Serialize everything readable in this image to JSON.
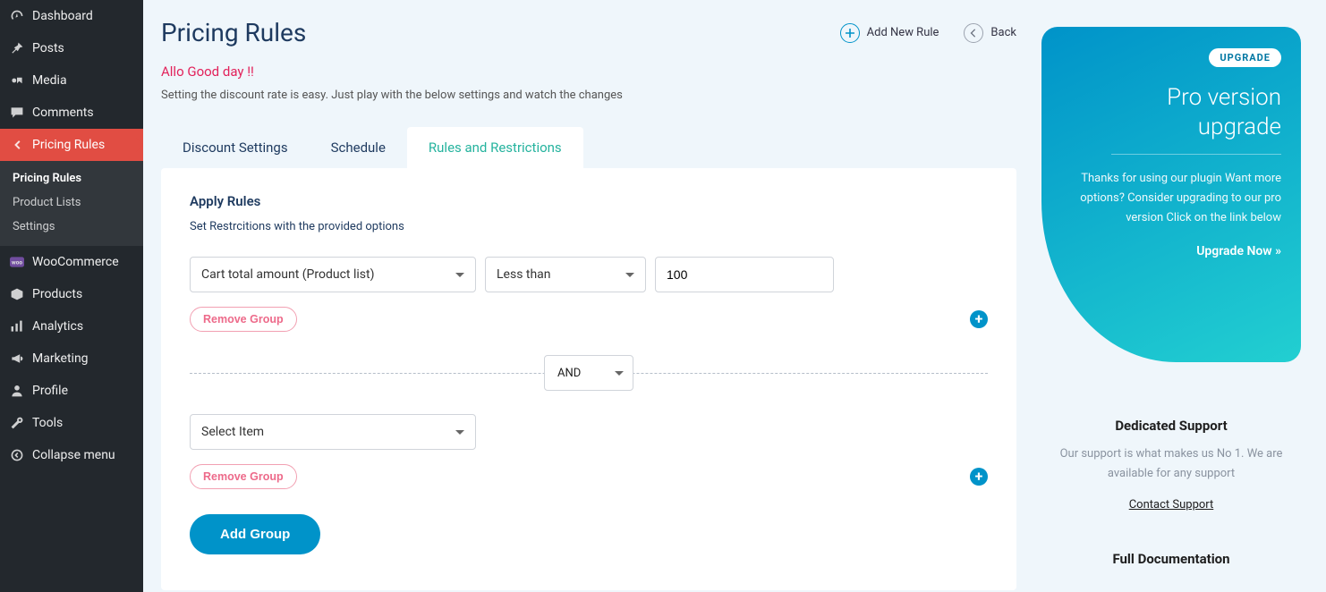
{
  "sidebar": {
    "items": [
      {
        "label": "Dashboard"
      },
      {
        "label": "Posts"
      },
      {
        "label": "Media"
      },
      {
        "label": "Comments"
      },
      {
        "label": "Pricing Rules"
      },
      {
        "label": "WooCommerce"
      },
      {
        "label": "Products"
      },
      {
        "label": "Analytics"
      },
      {
        "label": "Marketing"
      },
      {
        "label": "Profile"
      },
      {
        "label": "Tools"
      },
      {
        "label": "Collapse menu"
      }
    ],
    "sub": [
      {
        "label": "Pricing Rules"
      },
      {
        "label": "Product Lists"
      },
      {
        "label": "Settings"
      }
    ]
  },
  "header": {
    "title": "Pricing Rules",
    "add": "Add New Rule",
    "back": "Back"
  },
  "intro": {
    "greet": "Allo Good day !!",
    "desc": "Setting the discount rate is easy. Just play with the below settings and watch the changes"
  },
  "tabs": [
    "Discount Settings",
    "Schedule",
    "Rules and Restrictions"
  ],
  "section": {
    "title": "Apply Rules",
    "desc": "Set Restrcitions with the provided options"
  },
  "groups": [
    {
      "field": "Cart total amount (Product list)",
      "op": "Less than",
      "value": "100",
      "remove": "Remove Group"
    },
    {
      "field": "Select Item",
      "remove": "Remove Group"
    }
  ],
  "joiner": "AND",
  "add_group": "Add Group",
  "promo": {
    "badge": "UPGRADE",
    "title_l1": "Pro version",
    "title_l2": "upgrade",
    "body": "Thanks for using our plugin Want more options? Consider upgrading to our pro version Click on the link below",
    "cta": "Upgrade Now »"
  },
  "support": {
    "title": "Dedicated Support",
    "body": "Our support is what makes us No 1. We are available for any support",
    "link": "Contact Support"
  },
  "doc": {
    "title": "Full Documentation"
  }
}
